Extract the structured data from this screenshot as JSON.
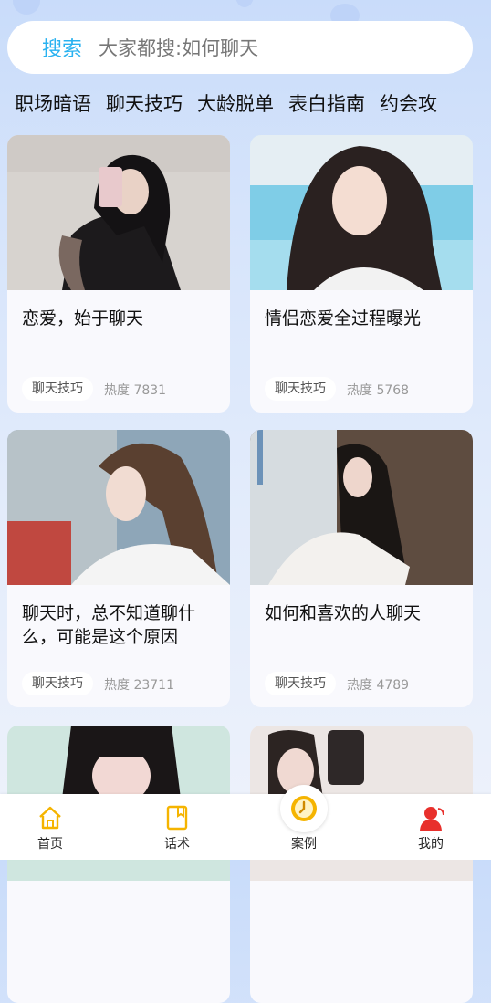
{
  "search": {
    "label": "搜索",
    "placeholder": "大家都搜:如何聊天"
  },
  "tabs": [
    "职场暗语",
    "聊天技巧",
    "大龄脱单",
    "表白指南",
    "约会攻"
  ],
  "cards": [
    {
      "title": "恋爱，始于聊天",
      "tag": "聊天技巧",
      "heat": "热度 7831"
    },
    {
      "title": "情侣恋爱全过程曝光",
      "tag": "聊天技巧",
      "heat": "热度 5768"
    },
    {
      "title": "聊天时，总不知道聊什么，可能是这个原因",
      "tag": "聊天技巧",
      "heat": "热度 23711"
    },
    {
      "title": "如何和喜欢的人聊天",
      "tag": "聊天技巧",
      "heat": "热度 4789"
    }
  ],
  "nav": [
    {
      "label": "首页",
      "icon": "home-icon"
    },
    {
      "label": "话术",
      "icon": "book-icon"
    },
    {
      "label": "案例",
      "icon": "clock-icon"
    },
    {
      "label": "我的",
      "icon": "user-icon"
    }
  ],
  "colors": {
    "accent": "#29b2f0",
    "nav_icon": "#f5b400",
    "profile_icon": "#e8302c"
  }
}
